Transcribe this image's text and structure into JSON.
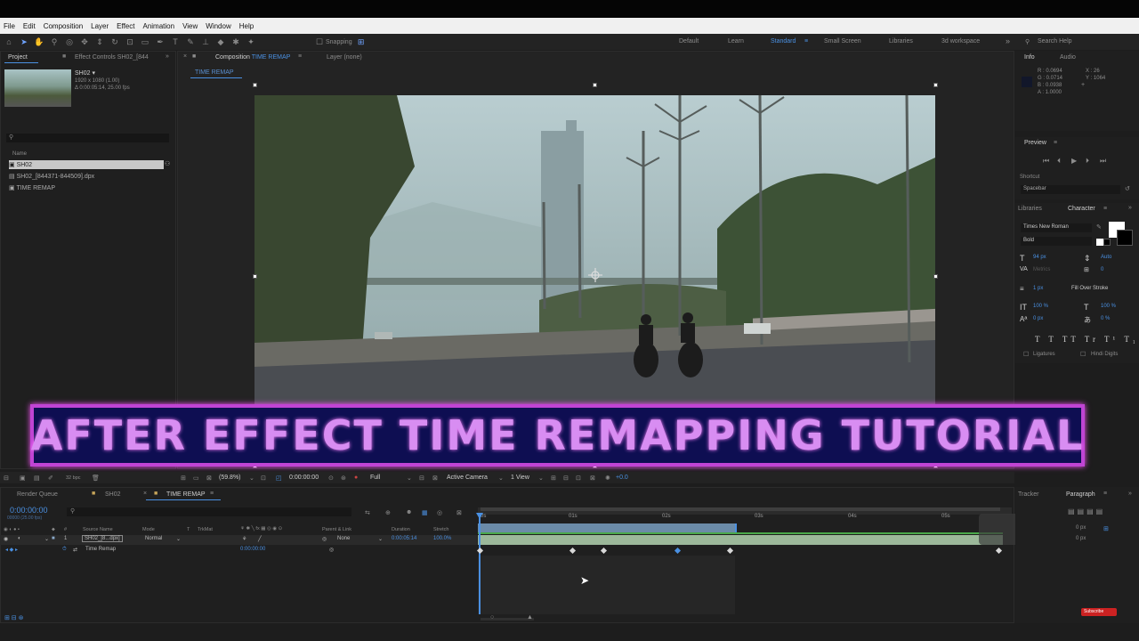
{
  "menu": [
    "File",
    "Edit",
    "Composition",
    "Layer",
    "Effect",
    "Animation",
    "View",
    "Window",
    "Help"
  ],
  "toolbar": {
    "snapping_label": "Snapping"
  },
  "workspaces": [
    {
      "label": "Default",
      "active": false
    },
    {
      "label": "Learn",
      "active": false
    },
    {
      "label": "Standard",
      "active": true
    },
    {
      "label": "Small Screen",
      "active": false
    },
    {
      "label": "Libraries",
      "active": false
    },
    {
      "label": "3d workspace",
      "active": false
    }
  ],
  "search_help": "Search Help",
  "project": {
    "tab": "Project",
    "effect_controls_tab": "Effect Controls SH02_[844",
    "footage_name": "SH02 ▾",
    "footage_info_1": "1920 x 1080 (1.00)",
    "footage_info_2": "Δ 0:00:05:14, 25.00 fps",
    "name_header": "Name",
    "items": [
      "SH02",
      "SH02_[844371-844509].dpx",
      "TIME REMAP"
    ]
  },
  "composition": {
    "tab_prefix": "Composition",
    "tab_name": "TIME REMAP",
    "layer_tab": "Layer (none)",
    "sub_tab": "TIME REMAP"
  },
  "banner_text": "AFTER EFFECT TIME REMAPPING TUTORIAL",
  "viewer_bar": {
    "bpc": "32 bpc",
    "zoom": "(59.8%)",
    "time": "0:00:00:00",
    "resolution": "Full",
    "camera": "Active Camera",
    "views": "1 View",
    "exposure": "+0.0"
  },
  "timeline": {
    "tabs": [
      "Render Queue",
      "SH02",
      "TIME REMAP"
    ],
    "current_time": "0:00:00:00",
    "current_frames": "00000 (25.00 fps)",
    "columns": [
      "Source Name",
      "Mode",
      "T",
      "TrkMat",
      "Parent & Link",
      "Duration",
      "Stretch"
    ],
    "layer_index": "1",
    "layer_name": "SH02_[8...dpx]",
    "layer_mode": "Normal",
    "layer_parent": "None",
    "layer_duration": "0:00:05:14",
    "layer_stretch": "100.0%",
    "prop_name": "Time Remap",
    "prop_value": "0:00:00:00",
    "ruler_labels": [
      "0s",
      "01s",
      "02s",
      "03s",
      "04s",
      "05s"
    ]
  },
  "info": {
    "tab": "Info",
    "audio_tab": "Audio",
    "r": "R : 0.0694",
    "g": "G : 0.0714",
    "b": "B : 0.0938",
    "a": "A : 1.0000",
    "x": "X : 26",
    "y": "Y : 1064"
  },
  "preview": {
    "tab": "Preview",
    "shortcut_label": "Shortcut",
    "shortcut_value": "Spacebar"
  },
  "character": {
    "libraries_tab": "Libraries",
    "tab": "Character",
    "font": "Times New Roman",
    "style": "Bold",
    "size": "94 px",
    "leading": "Auto",
    "tracking_label": "Metrics",
    "tracking_value": "0",
    "stroke": "1 px",
    "stroke_type": "Fill Over Stroke",
    "v_scale": "100 %",
    "h_scale": "100 %",
    "baseline": "0 px",
    "tsume": "0 %",
    "ligatures": "Ligatures",
    "hindi_digits": "Hindi Digits"
  },
  "bottom_right": {
    "tracker_tab": "Tracker",
    "paragraph_tab": "Paragraph",
    "para_1": "0 px",
    "para_2": "0 px",
    "subscribe": "Subscribe"
  },
  "colors": {
    "accent": "#4a90e2",
    "banner_border": "#c044d4",
    "banner_bg": "#0e0e52",
    "banner_text": "#d88df2"
  }
}
